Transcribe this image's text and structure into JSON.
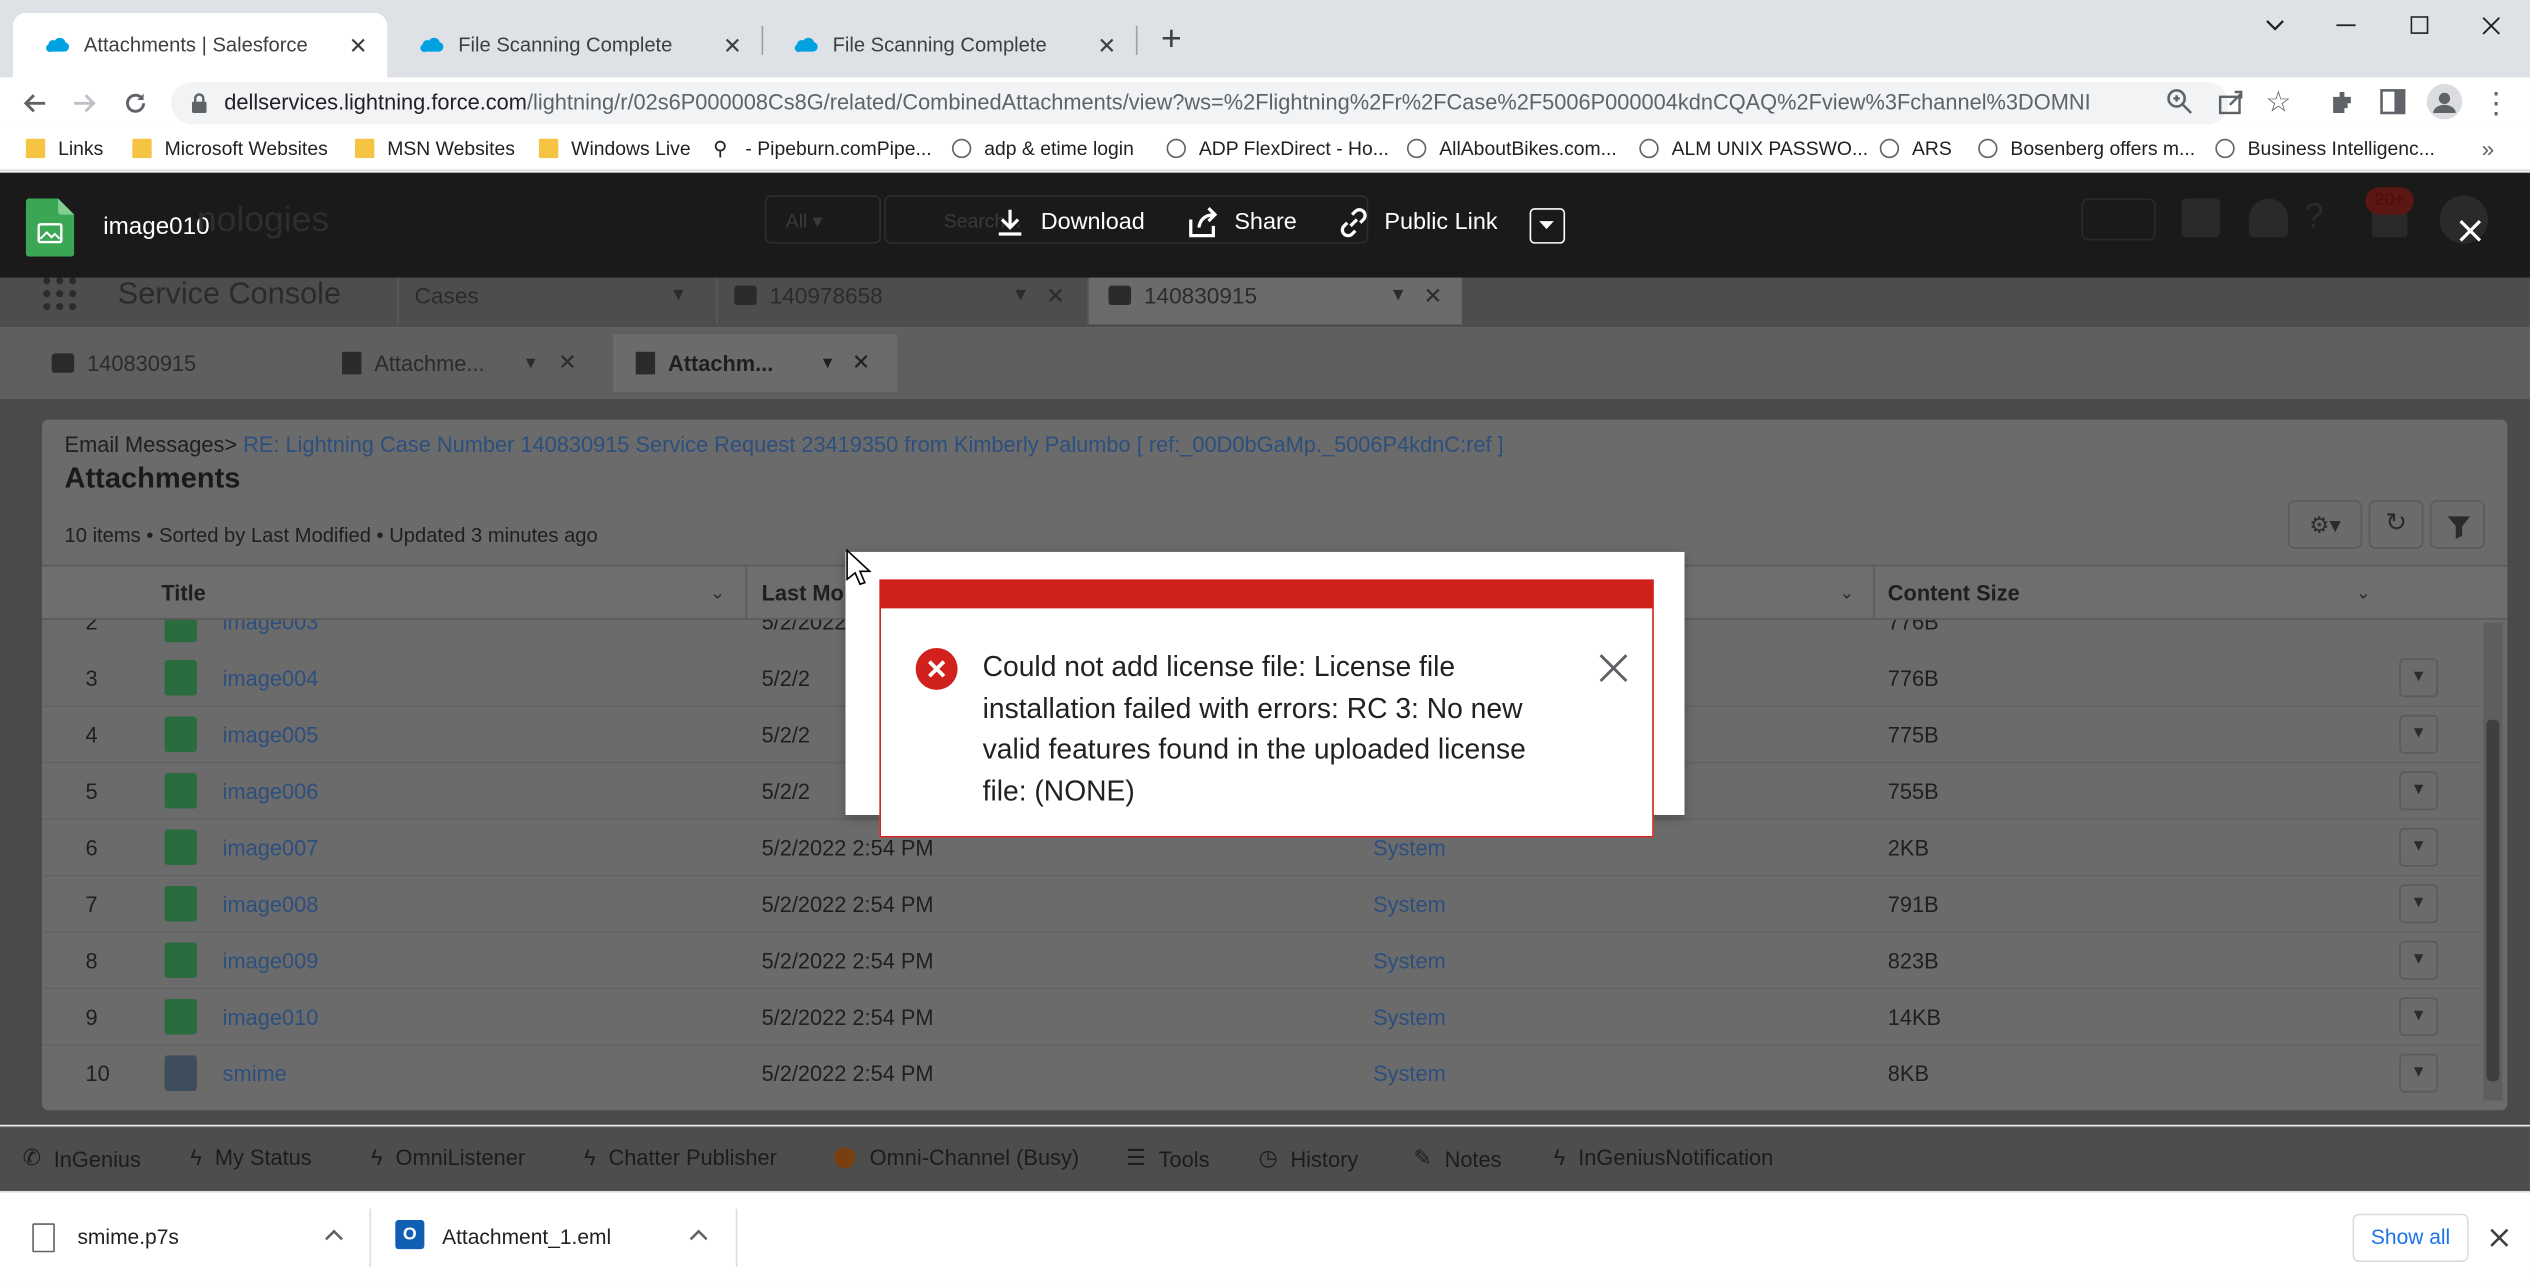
{
  "browser": {
    "tabs": [
      {
        "title": "Attachments | Salesforce",
        "active": true
      },
      {
        "title": "File Scanning Complete",
        "active": false
      },
      {
        "title": "File Scanning Complete",
        "active": false
      }
    ],
    "url_host": "dellservices.lightning.force.com",
    "url_path": "/lightning/r/02s6P000008Cs8G/related/CombinedAttachments/view?ws=%2Flightning%2Fr%2FCase%2F5006P000004kdnCQAQ%2Fview%3Fchannel%3DOMNI",
    "bookmarks": [
      "Links",
      "Microsoft Websites",
      "MSN Websites",
      "Windows Live",
      "- Pipeburn.comPipe...",
      "adp & etime login",
      "ADP FlexDirect - Ho...",
      "AllAboutBikes.com...",
      "ALM UNIX PASSWO...",
      "ARS",
      "Bosenberg offers m...",
      "Business Intelligenc..."
    ]
  },
  "preview": {
    "file_name": "image010",
    "download_label": "Download",
    "share_label": "Share",
    "public_link_label": "Public Link",
    "behind_title": "nologies",
    "behind_search_scope": "All",
    "behind_search": "Search..."
  },
  "console": {
    "app_name": "Service Console",
    "nav_select": "Cases",
    "workspace_tabs": [
      "140978658",
      "140830915"
    ],
    "sub_tabs": [
      "140830915",
      "Attachme...",
      "Attachm..."
    ]
  },
  "list": {
    "breadcrumb_prefix": "Email Messages",
    "breadcrumb_link": "RE: Lightning Case Number 140830915 Service Request 23419350 from Kimberly Palumbo [ ref:_00D0bGaMp._5006P4kdnC:ref ]",
    "title": "Attachments",
    "meta": "10 items • Sorted by Last Modified • Updated 3 minutes ago",
    "columns": [
      "Title",
      "Last Mo",
      "Content Size"
    ],
    "partial_row": {
      "num": "2",
      "title": "image003",
      "date": "5/2/2022",
      "size": "776B"
    },
    "rows": [
      {
        "num": "3",
        "title": "image004",
        "date": "5/2/2",
        "by": "",
        "size": "776B"
      },
      {
        "num": "4",
        "title": "image005",
        "date": "5/2/2",
        "by": "",
        "size": "775B"
      },
      {
        "num": "5",
        "title": "image006",
        "date": "5/2/2",
        "by": "",
        "size": "755B"
      },
      {
        "num": "6",
        "title": "image007",
        "date": "5/2/2022 2:54 PM",
        "by": "System",
        "size": "2KB"
      },
      {
        "num": "7",
        "title": "image008",
        "date": "5/2/2022 2:54 PM",
        "by": "System",
        "size": "791B"
      },
      {
        "num": "8",
        "title": "image009",
        "date": "5/2/2022 2:54 PM",
        "by": "System",
        "size": "823B"
      },
      {
        "num": "9",
        "title": "image010",
        "date": "5/2/2022 2:54 PM",
        "by": "System",
        "size": "14KB"
      },
      {
        "num": "10",
        "title": "smime",
        "date": "5/2/2022 2:54 PM",
        "by": "System",
        "size": "8KB"
      }
    ]
  },
  "utility_bar": [
    "InGenius",
    "My Status",
    "OmniListener",
    "Chatter Publisher",
    "Omni-Channel (Busy)",
    "Tools",
    "History",
    "Notes",
    "InGeniusNotification"
  ],
  "downloads": {
    "items": [
      "smime.p7s",
      "Attachment_1.eml"
    ],
    "show_all": "Show all"
  },
  "error_toast": {
    "message": "Could not add license file: License file installation failed with errors: RC 3: No new valid features found in the uploaded license file: (NONE)"
  },
  "colors": {
    "error_red": "#d0211c",
    "link_blue": "#0176d3",
    "preview_header": "#1a1a1a"
  }
}
